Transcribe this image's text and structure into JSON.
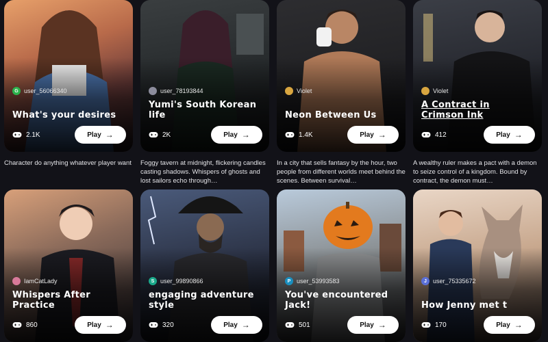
{
  "cards": [
    {
      "user": "user_56066340",
      "avatar": "G",
      "avatar_color": "#2bb24c",
      "title": "What's your desires",
      "plays": "2.1K",
      "play_label": "Play",
      "description": "Character do anything whatever player want"
    },
    {
      "user": "user_78193844",
      "avatar": "",
      "avatar_color": "#8c8c9c",
      "title": "Yumi's South Korean life",
      "plays": "2K",
      "play_label": "Play",
      "description": "Foggy tavern at midnight, flickering candles casting shadows. Whispers of ghosts and lost sailors echo through…"
    },
    {
      "user": "Violet",
      "avatar": "",
      "avatar_color": "#d9a640",
      "title": "Neon Between Us",
      "plays": "1.4K",
      "play_label": "Play",
      "description": "In a city that sells fantasy by the hour, two people from different worlds meet behind the scenes. Between survival…"
    },
    {
      "user": "Violet",
      "avatar": "",
      "avatar_color": "#d9a640",
      "title": "A Contract in Crimson Ink",
      "plays": "412",
      "play_label": "Play",
      "description": "A wealthy ruler makes a pact with a demon to seize control of a kingdom. Bound by contract, the demon must…"
    },
    {
      "user": "IamCatLady",
      "avatar": "",
      "avatar_color": "#d87a9a",
      "title": "Whispers After Practice",
      "plays": "860",
      "play_label": "Play"
    },
    {
      "user": "user_99890866",
      "avatar": "S",
      "avatar_color": "#1aa88a",
      "title": "engaging adventure style",
      "plays": "320",
      "play_label": "Play"
    },
    {
      "user": "user_53993583",
      "avatar": "P",
      "avatar_color": "#1a8fbf",
      "title": "You've encountered Jack!",
      "plays": "501",
      "play_label": "Play"
    },
    {
      "user": "user_75335672",
      "avatar": "J",
      "avatar_color": "#5a6fd6",
      "title": "How Jenny met t",
      "plays": "170",
      "play_label": "Play"
    }
  ]
}
